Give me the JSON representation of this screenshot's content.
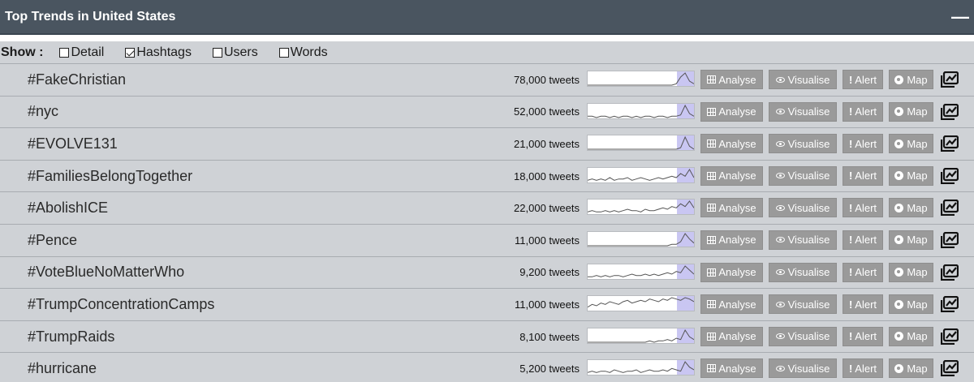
{
  "header": {
    "title": "Top Trends in United States",
    "minimize_label": "—"
  },
  "show": {
    "label": "Show :",
    "options": [
      {
        "label": "Detail",
        "checked": false
      },
      {
        "label": "Hashtags",
        "checked": true
      },
      {
        "label": "Users",
        "checked": false
      },
      {
        "label": "Words",
        "checked": false
      }
    ]
  },
  "buttons": {
    "analyse": "Analyse",
    "visualise": "Visualise",
    "alert": "Alert",
    "alert_glyph": "!",
    "map": "Map"
  },
  "trends": [
    {
      "name": "#FakeChristian",
      "count": "78,000 tweets",
      "spark": [
        0,
        0,
        0,
        0,
        0,
        0,
        0,
        0,
        0,
        0,
        0,
        0,
        0,
        0,
        0,
        0,
        0,
        0,
        0,
        0,
        1,
        6,
        9,
        3,
        1
      ]
    },
    {
      "name": "#nyc",
      "count": "52,000 tweets",
      "spark": [
        1,
        1,
        0,
        1,
        1,
        0,
        1,
        0,
        1,
        1,
        0,
        1,
        0,
        1,
        1,
        0,
        1,
        1,
        0,
        1,
        1,
        2,
        9,
        3,
        1
      ]
    },
    {
      "name": "#EVOLVE131",
      "count": "21,000 tweets",
      "spark": [
        0,
        0,
        0,
        0,
        0,
        0,
        0,
        0,
        0,
        0,
        0,
        0,
        0,
        0,
        0,
        0,
        0,
        0,
        0,
        0,
        0,
        1,
        8,
        2,
        0
      ]
    },
    {
      "name": "#FamiliesBelongTogether",
      "count": "18,000 tweets",
      "spark": [
        1,
        2,
        1,
        2,
        1,
        3,
        1,
        2,
        2,
        3,
        1,
        2,
        3,
        2,
        1,
        2,
        3,
        2,
        3,
        4,
        3,
        6,
        4,
        9,
        3
      ]
    },
    {
      "name": "#AbolishICE",
      "count": "22,000 tweets",
      "spark": [
        1,
        2,
        1,
        1,
        2,
        1,
        2,
        1,
        2,
        3,
        2,
        2,
        1,
        3,
        2,
        2,
        3,
        4,
        3,
        5,
        4,
        7,
        5,
        9,
        4
      ]
    },
    {
      "name": "#Pence",
      "count": "11,000 tweets",
      "spark": [
        0,
        0,
        0,
        0,
        0,
        0,
        0,
        0,
        0,
        0,
        0,
        0,
        0,
        0,
        0,
        0,
        0,
        0,
        0,
        1,
        1,
        3,
        9,
        5,
        2
      ]
    },
    {
      "name": "#VoteBlueNoMatterWho",
      "count": "9,200 tweets",
      "spark": [
        1,
        1,
        2,
        1,
        2,
        1,
        2,
        2,
        1,
        2,
        3,
        2,
        2,
        3,
        2,
        3,
        2,
        3,
        4,
        3,
        5,
        4,
        9,
        6,
        3
      ]
    },
    {
      "name": "#TrumpConcentrationCamps",
      "count": "11,000 tweets",
      "spark": [
        2,
        4,
        3,
        5,
        4,
        6,
        5,
        4,
        6,
        7,
        5,
        6,
        7,
        6,
        8,
        7,
        6,
        8,
        7,
        9,
        8,
        7,
        9,
        8,
        6
      ]
    },
    {
      "name": "#TrumpRaids",
      "count": "8,100 tweets",
      "spark": [
        0,
        0,
        0,
        0,
        0,
        0,
        0,
        0,
        0,
        0,
        0,
        0,
        0,
        0,
        1,
        0,
        1,
        1,
        2,
        1,
        3,
        2,
        9,
        4,
        2
      ]
    },
    {
      "name": "#hurricane",
      "count": "5,200 tweets",
      "spark": [
        1,
        2,
        1,
        2,
        2,
        1,
        3,
        2,
        1,
        2,
        2,
        3,
        1,
        2,
        3,
        2,
        2,
        3,
        2,
        4,
        3,
        2,
        9,
        5,
        3
      ]
    }
  ],
  "colors": {
    "header_bg": "#4a5560",
    "panel_bg": "#cfd2d6",
    "button_bg": "#9a9a9a",
    "spark_line": "#555555",
    "spark_fill": "#c9c6f2"
  }
}
